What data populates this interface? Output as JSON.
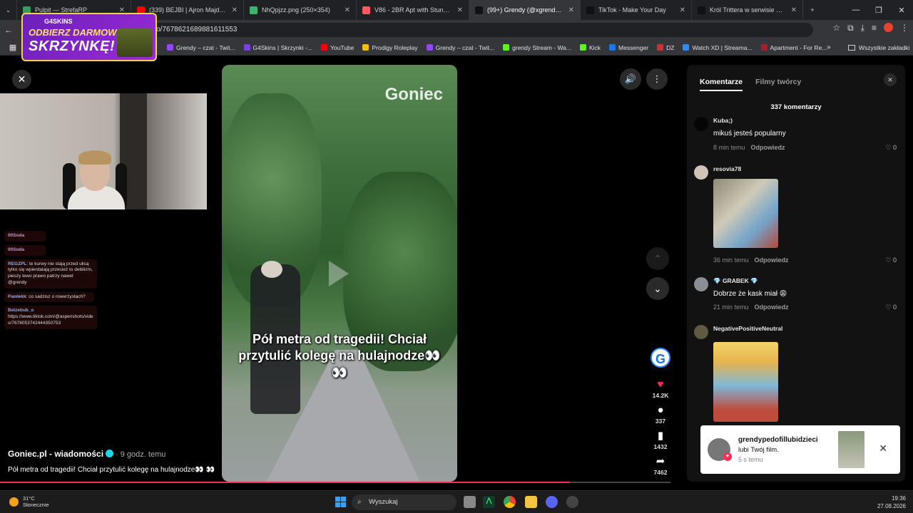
{
  "browser": {
    "tabs": [
      {
        "title": "Pulpit — StrefaRP",
        "color": "#3a9b5c"
      },
      {
        "title": "(339) BEJBI | Ajron Majdan z Du",
        "color": "#ff0000"
      },
      {
        "title": "NhQpjzz.png (250×354)",
        "color": "#3cb371"
      },
      {
        "title": "V86 - 2BR Apt with Stunning G",
        "color": "#ff5a5f"
      },
      {
        "title": "(99+) Grendy (@xgrendy) | TikTo",
        "color": "#111111"
      },
      {
        "title": "TikTok - Make Your Day",
        "color": "#111111"
      },
      {
        "title": "Król Trittera w serwisie X: „Czte",
        "color": "#111111"
      }
    ],
    "url": "deo/7678621689881611553",
    "bookmarks": [
      {
        "label": "Grendy – czat - Twit...",
        "color": "#9146ff"
      },
      {
        "label": "G4Skins | Skrzynki -...",
        "color": "#7b3fe4"
      },
      {
        "label": "YouTube",
        "color": "#ff0000"
      },
      {
        "label": "Prodigy Roleplay",
        "color": "#f2c200"
      },
      {
        "label": "Grendy – czat - Twit...",
        "color": "#9146ff"
      },
      {
        "label": "grendy Stream - Wa...",
        "color": "#53fc18"
      },
      {
        "label": "Kick",
        "color": "#53fc18"
      },
      {
        "label": "Messenger",
        "color": "#1877f2"
      },
      {
        "label": "DZ",
        "color": "#d32f2f"
      },
      {
        "label": "Watch XD | Streama...",
        "color": "#2a8cff"
      },
      {
        "label": "Apartment - For Re...",
        "color": "#ae1c28"
      }
    ],
    "all_bookmarks": "Wszystkie zakładki"
  },
  "ad": {
    "brand": "G4SKINS",
    "line1": "ODBIERZ DARMOWĄ",
    "line2": "SKRZYNKĘ!"
  },
  "stream": {
    "chat": [
      {
        "user": "00Soda",
        "text": ""
      },
      {
        "user": "00Soda",
        "text": ""
      },
      {
        "user": "REGZPL",
        "text": "te kurwy nie stają przed ulicą tylko się wpierdalają przecież to debilizm, pieszy lewo prawo patrzy nawet @grendy"
      },
      {
        "user": "Pawlekk",
        "text": "co sadzisz o rowerzystach?"
      },
      {
        "user": "Belzebub_o",
        "text": "https://www.tiktok.com/@aspenshots/video/7678053742444350753"
      }
    ]
  },
  "video": {
    "watermark": "Goniec",
    "caption": "Pół metra od tragedii! Chciał przytulić kolegę na hulajnodze👀👀",
    "author": "Goniec.pl - wiadomości",
    "posted": "· 9 godz. temu",
    "description": "Pół metra od tragedii! Chciał przytulić kolegę na hulajnodze👀 👀",
    "likes": "14.2K",
    "comments": "337",
    "saves": "1432",
    "shares": "7462",
    "progress": 0.85,
    "creator_avatar_letter": "G"
  },
  "comments_panel": {
    "tab_comments": "Komentarze",
    "tab_creator": "Filmy twórcy",
    "count": "337 komentarzy",
    "reply": "Odpowiedz",
    "items": [
      {
        "user": "Kuba;)",
        "text": "mikuś jesteś popularny",
        "time": "8 min temu",
        "likes": "0"
      },
      {
        "user": "resovia78",
        "text": "",
        "time": "36 min temu",
        "likes": "0"
      },
      {
        "user": "💎 GRABEK 💎",
        "text": "Dobrze że kask miał 😩",
        "time": "21 min temu",
        "likes": "0"
      },
      {
        "user": "NegativePositiveNeutral",
        "text": "",
        "time": "",
        "likes": ""
      }
    ]
  },
  "notification": {
    "user": "grendypedofillubidzieci",
    "text": "lubi Twój film.",
    "time": "5 s temu"
  },
  "taskbar": {
    "temp": "31°C",
    "weather": "Słonecznie",
    "search": "Wyszukaj",
    "time": "19:36",
    "date": "27.08.2026"
  }
}
